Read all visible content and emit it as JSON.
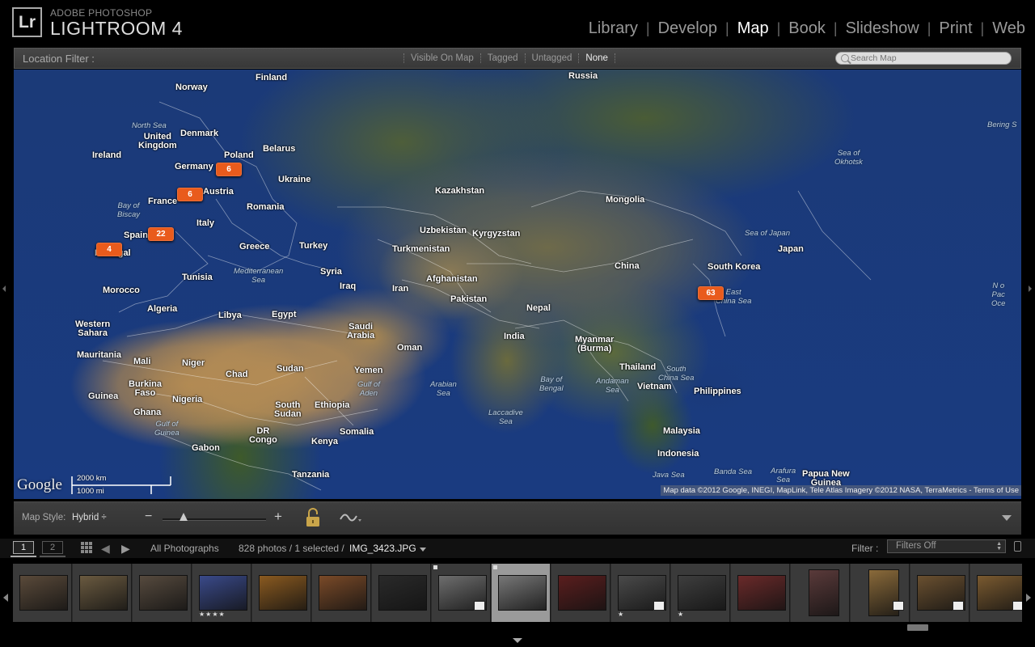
{
  "app": {
    "logo_text": "Lr",
    "brand_small": "ADOBE PHOTOSHOP",
    "brand_large": "LIGHTROOM 4"
  },
  "modules": [
    {
      "label": "Library",
      "active": false
    },
    {
      "label": "Develop",
      "active": false
    },
    {
      "label": "Map",
      "active": true
    },
    {
      "label": "Book",
      "active": false
    },
    {
      "label": "Slideshow",
      "active": false
    },
    {
      "label": "Print",
      "active": false
    },
    {
      "label": "Web",
      "active": false
    }
  ],
  "location_filter": {
    "label": "Location Filter :",
    "options": [
      "Visible On Map",
      "Tagged",
      "Untagged",
      "None"
    ],
    "selected": "None",
    "search_placeholder": "Search Map"
  },
  "map": {
    "places": [
      {
        "name": "Finland",
        "type": "land"
      },
      {
        "name": "Norway",
        "type": "land"
      },
      {
        "name": "Russia",
        "type": "land"
      },
      {
        "name": "North Sea",
        "type": "sea"
      },
      {
        "name": "Denmark",
        "type": "land"
      },
      {
        "name": "United\nKingdom",
        "type": "land"
      },
      {
        "name": "Ireland",
        "type": "land"
      },
      {
        "name": "Poland",
        "type": "land"
      },
      {
        "name": "Belarus",
        "type": "land"
      },
      {
        "name": "Germany",
        "type": "land"
      },
      {
        "name": "Austria",
        "type": "land"
      },
      {
        "name": "Ukraine",
        "type": "land"
      },
      {
        "name": "France",
        "type": "land"
      },
      {
        "name": "Bay of\nBiscay",
        "type": "sea"
      },
      {
        "name": "Romania",
        "type": "land"
      },
      {
        "name": "Italy",
        "type": "land"
      },
      {
        "name": "Spain",
        "type": "land"
      },
      {
        "name": "Portugal",
        "type": "land"
      },
      {
        "name": "Greece",
        "type": "land"
      },
      {
        "name": "Turkey",
        "type": "land"
      },
      {
        "name": "Mediterranean\nSea",
        "type": "sea"
      },
      {
        "name": "Tunisia",
        "type": "land"
      },
      {
        "name": "Syria",
        "type": "land"
      },
      {
        "name": "Iraq",
        "type": "land"
      },
      {
        "name": "Iran",
        "type": "land"
      },
      {
        "name": "Morocco",
        "type": "land"
      },
      {
        "name": "Algeria",
        "type": "land"
      },
      {
        "name": "Libya",
        "type": "land"
      },
      {
        "name": "Egypt",
        "type": "land"
      },
      {
        "name": "Western\nSahara",
        "type": "land"
      },
      {
        "name": "Saudi\nArabia",
        "type": "land"
      },
      {
        "name": "Oman",
        "type": "land"
      },
      {
        "name": "Mauritania",
        "type": "land"
      },
      {
        "name": "Mali",
        "type": "land"
      },
      {
        "name": "Niger",
        "type": "land"
      },
      {
        "name": "Chad",
        "type": "land"
      },
      {
        "name": "Sudan",
        "type": "land"
      },
      {
        "name": "Yemen",
        "type": "land"
      },
      {
        "name": "Gulf of\nAden",
        "type": "sea"
      },
      {
        "name": "Burkina\nFaso",
        "type": "land"
      },
      {
        "name": "Guinea",
        "type": "land"
      },
      {
        "name": "Nigeria",
        "type": "land"
      },
      {
        "name": "Ghana",
        "type": "land"
      },
      {
        "name": "South\nSudan",
        "type": "land"
      },
      {
        "name": "Ethiopia",
        "type": "land"
      },
      {
        "name": "Gulf of\nGuinea",
        "type": "sea"
      },
      {
        "name": "Somalia",
        "type": "land"
      },
      {
        "name": "Gabon",
        "type": "land"
      },
      {
        "name": "DR\nCongo",
        "type": "land"
      },
      {
        "name": "Kenya",
        "type": "land"
      },
      {
        "name": "Tanzania",
        "type": "land"
      },
      {
        "name": "Kazakhstan",
        "type": "land"
      },
      {
        "name": "Uzbekistan",
        "type": "land"
      },
      {
        "name": "Kyrgyzstan",
        "type": "land"
      },
      {
        "name": "Turkmenistan",
        "type": "land"
      },
      {
        "name": "Afghanistan",
        "type": "land"
      },
      {
        "name": "Pakistan",
        "type": "land"
      },
      {
        "name": "Nepal",
        "type": "land"
      },
      {
        "name": "India",
        "type": "land"
      },
      {
        "name": "Arabian\nSea",
        "type": "sea"
      },
      {
        "name": "Laccadive\nSea",
        "type": "sea"
      },
      {
        "name": "Bay of\nBengal",
        "type": "sea"
      },
      {
        "name": "Andaman\nSea",
        "type": "sea"
      },
      {
        "name": "Myanmar\n(Burma)",
        "type": "land"
      },
      {
        "name": "Thailand",
        "type": "land"
      },
      {
        "name": "Vietnam",
        "type": "land"
      },
      {
        "name": "South\nChina Sea",
        "type": "sea"
      },
      {
        "name": "Philippines",
        "type": "land"
      },
      {
        "name": "Malaysia",
        "type": "land"
      },
      {
        "name": "Indonesia",
        "type": "land"
      },
      {
        "name": "Java Sea",
        "type": "sea"
      },
      {
        "name": "Banda Sea",
        "type": "sea"
      },
      {
        "name": "Arafura\nSea",
        "type": "sea"
      },
      {
        "name": "Papua New\nGuinea",
        "type": "land"
      },
      {
        "name": "Mongolia",
        "type": "land"
      },
      {
        "name": "China",
        "type": "land"
      },
      {
        "name": "South Korea",
        "type": "land"
      },
      {
        "name": "Japan",
        "type": "land"
      },
      {
        "name": "Sea of Japan",
        "type": "sea"
      },
      {
        "name": "East\nChina Sea",
        "type": "sea"
      },
      {
        "name": "Sea of\nOkhotsk",
        "type": "sea"
      },
      {
        "name": "Bering S",
        "type": "sea"
      },
      {
        "name": "N o\nPac\nOce",
        "type": "sea"
      }
    ],
    "photo_pins": [
      {
        "count": "6",
        "location": "Germany"
      },
      {
        "count": "6",
        "location": "France"
      },
      {
        "count": "22",
        "location": "Spain"
      },
      {
        "count": "4",
        "location": "Portugal"
      },
      {
        "count": "63",
        "location": "East China"
      }
    ],
    "google_logo": "Google",
    "scale_km": "2000 km",
    "scale_mi": "1000 mi",
    "attribution": "Map data ©2012 Google, INEGI, MapLink, Tele Atlas Imagery ©2012 NASA, TerraMetrics - Terms of Use"
  },
  "map_toolbar": {
    "style_label": "Map Style:",
    "style_value": "Hybrid ÷",
    "zoom_minus": "−",
    "zoom_plus": "+",
    "zoom_level": 0.2
  },
  "filmstrip_header": {
    "monitor1": "1",
    "monitor2": "2",
    "source": "All Photographs",
    "count": "828 photos / 1 selected /",
    "filename": "IMG_3423.JPG",
    "filter_label": "Filter :",
    "filter_value": "Filters Off"
  },
  "filmstrip": {
    "thumbnails": [
      {
        "stars": "",
        "tone": "#5a4a3a",
        "badge": false,
        "selected": false,
        "portrait": false
      },
      {
        "stars": "",
        "tone": "#6a5a40",
        "badge": false,
        "selected": false,
        "portrait": false
      },
      {
        "stars": "",
        "tone": "#564a3e",
        "badge": false,
        "selected": false,
        "portrait": false
      },
      {
        "stars": "★★★★",
        "tone": "#3a4a8a",
        "badge": false,
        "selected": false,
        "portrait": false
      },
      {
        "stars": "",
        "tone": "#8a5a20",
        "badge": false,
        "selected": false,
        "portrait": false
      },
      {
        "stars": "",
        "tone": "#7a4a28",
        "badge": false,
        "selected": false,
        "portrait": false
      },
      {
        "stars": "",
        "tone": "#2a2a2a",
        "badge": false,
        "selected": false,
        "portrait": false
      },
      {
        "stars": "",
        "tone": "#6e6e6e",
        "badge": true,
        "selected": false,
        "portrait": false
      },
      {
        "stars": "",
        "tone": "#777777",
        "badge": false,
        "selected": true,
        "portrait": false
      },
      {
        "stars": "",
        "tone": "#5a1e1e",
        "badge": false,
        "selected": false,
        "portrait": false
      },
      {
        "stars": "★",
        "tone": "#4a4a4a",
        "badge": true,
        "selected": false,
        "portrait": false
      },
      {
        "stars": "★",
        "tone": "#3e3e3e",
        "badge": false,
        "selected": false,
        "portrait": false
      },
      {
        "stars": "",
        "tone": "#6a2a2a",
        "badge": false,
        "selected": false,
        "portrait": false
      },
      {
        "stars": "",
        "tone": "#5a3a3a",
        "badge": false,
        "selected": false,
        "portrait": true
      },
      {
        "stars": "",
        "tone": "#8a6a3a",
        "badge": true,
        "selected": false,
        "portrait": true
      },
      {
        "stars": "",
        "tone": "#6a5030",
        "badge": true,
        "selected": false,
        "portrait": false
      },
      {
        "stars": "",
        "tone": "#7a5a30",
        "badge": true,
        "selected": false,
        "portrait": false
      }
    ]
  }
}
